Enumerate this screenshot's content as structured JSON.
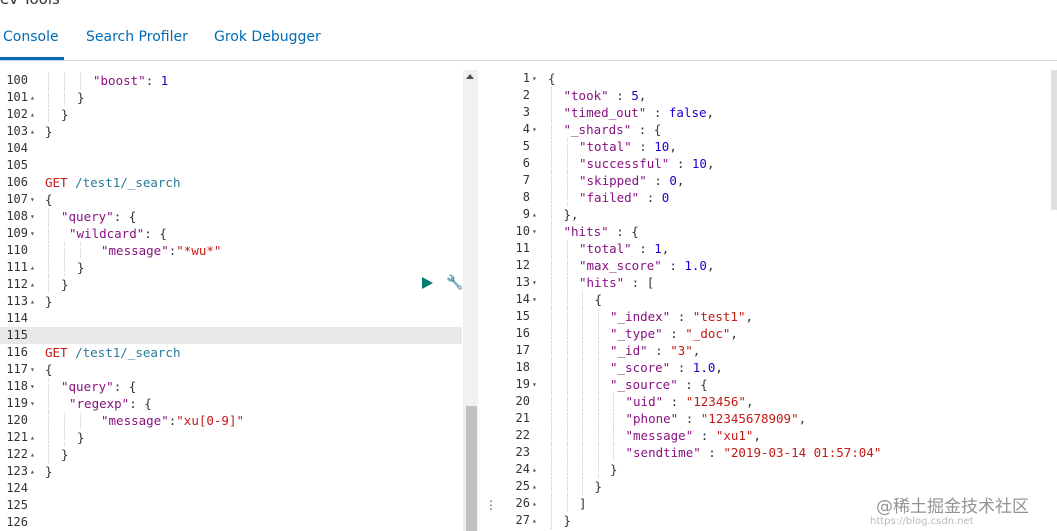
{
  "app": {
    "title": "ev Tools"
  },
  "tabs": [
    {
      "label": "Console"
    },
    {
      "label": "Search Profiler"
    },
    {
      "label": "Grok Debugger"
    }
  ],
  "watermark": "@稀土掘金技术社区",
  "watermark_url": "https://blog.csdn.net",
  "left_lines": [
    {
      "n": "100",
      "fold": "",
      "indent": 3,
      "t": [
        [
          "k",
          "\"boost\""
        ],
        [
          "p",
          ": "
        ],
        [
          "n",
          "1"
        ]
      ]
    },
    {
      "n": "101",
      "fold": "▴",
      "indent": 2,
      "t": [
        [
          "p",
          "}"
        ]
      ]
    },
    {
      "n": "102",
      "fold": "▴",
      "indent": 1,
      "t": [
        [
          "p",
          "}"
        ]
      ]
    },
    {
      "n": "103",
      "fold": "▴",
      "indent": 0,
      "t": [
        [
          "p",
          "}"
        ]
      ]
    },
    {
      "n": "104",
      "fold": "",
      "indent": 0,
      "t": []
    },
    {
      "n": "105",
      "fold": "",
      "indent": 0,
      "t": []
    },
    {
      "n": "106",
      "fold": "",
      "indent": 0,
      "t": [
        [
          "method",
          "GET "
        ],
        [
          "url",
          "/test1/_search"
        ]
      ]
    },
    {
      "n": "107",
      "fold": "▾",
      "indent": 0,
      "t": [
        [
          "p",
          "{"
        ]
      ]
    },
    {
      "n": "108",
      "fold": "▾",
      "indent": 1,
      "t": [
        [
          "k",
          "\"query\""
        ],
        [
          "p",
          ": {"
        ]
      ]
    },
    {
      "n": "109",
      "fold": "▾",
      "indent": 1.5,
      "t": [
        [
          "k",
          "\"wildcard\""
        ],
        [
          "p",
          ": {"
        ]
      ]
    },
    {
      "n": "110",
      "fold": "",
      "indent": 3.5,
      "t": [
        [
          "k",
          "\"message\""
        ],
        [
          "p",
          ":"
        ],
        [
          "str",
          "\"*wu*\""
        ]
      ]
    },
    {
      "n": "111",
      "fold": "▴",
      "indent": 2,
      "t": [
        [
          "p",
          "}"
        ]
      ]
    },
    {
      "n": "112",
      "fold": "▴",
      "indent": 1,
      "t": [
        [
          "p",
          "}"
        ]
      ]
    },
    {
      "n": "113",
      "fold": "▴",
      "indent": 0,
      "t": [
        [
          "p",
          "}"
        ]
      ]
    },
    {
      "n": "114",
      "fold": "",
      "indent": 0,
      "t": []
    },
    {
      "n": "115",
      "fold": "",
      "indent": 0,
      "t": []
    },
    {
      "n": "116",
      "fold": "",
      "indent": 0,
      "t": [
        [
          "method",
          "GET "
        ],
        [
          "url",
          "/test1/_search"
        ]
      ]
    },
    {
      "n": "117",
      "fold": "▾",
      "indent": 0,
      "t": [
        [
          "p",
          "{"
        ]
      ]
    },
    {
      "n": "118",
      "fold": "▾",
      "indent": 1,
      "t": [
        [
          "k",
          "\"query\""
        ],
        [
          "p",
          ": {"
        ]
      ]
    },
    {
      "n": "119",
      "fold": "▾",
      "indent": 1.5,
      "t": [
        [
          "k",
          "\"regexp\""
        ],
        [
          "p",
          ": {"
        ]
      ]
    },
    {
      "n": "120",
      "fold": "",
      "indent": 3.5,
      "t": [
        [
          "k",
          "\"message\""
        ],
        [
          "p",
          ":"
        ],
        [
          "str",
          "\"xu[0-9]\""
        ]
      ]
    },
    {
      "n": "121",
      "fold": "▴",
      "indent": 2,
      "t": [
        [
          "p",
          "}"
        ]
      ]
    },
    {
      "n": "122",
      "fold": "▴",
      "indent": 1,
      "t": [
        [
          "p",
          "}"
        ]
      ]
    },
    {
      "n": "123",
      "fold": "▴",
      "indent": 0,
      "t": [
        [
          "p",
          "}"
        ]
      ]
    },
    {
      "n": "124",
      "fold": "",
      "indent": 0,
      "t": []
    },
    {
      "n": "125",
      "fold": "",
      "indent": 0,
      "t": []
    },
    {
      "n": "126",
      "fold": "",
      "indent": 0,
      "t": []
    }
  ],
  "right_lines": [
    {
      "n": "1",
      "fold": "▾",
      "indent": 0,
      "t": [
        [
          "p",
          "{"
        ]
      ]
    },
    {
      "n": "2",
      "fold": "",
      "indent": 1,
      "t": [
        [
          "k",
          "\"took\""
        ],
        [
          "p",
          " : "
        ],
        [
          "n",
          "5"
        ],
        [
          "p",
          ","
        ]
      ]
    },
    {
      "n": "3",
      "fold": "",
      "indent": 1,
      "t": [
        [
          "k",
          "\"timed_out\""
        ],
        [
          "p",
          " : "
        ],
        [
          "kw",
          "false"
        ],
        [
          "p",
          ","
        ]
      ]
    },
    {
      "n": "4",
      "fold": "▾",
      "indent": 1,
      "t": [
        [
          "k",
          "\"_shards\""
        ],
        [
          "p",
          " : {"
        ]
      ]
    },
    {
      "n": "5",
      "fold": "",
      "indent": 2,
      "t": [
        [
          "k",
          "\"total\""
        ],
        [
          "p",
          " : "
        ],
        [
          "n",
          "10"
        ],
        [
          "p",
          ","
        ]
      ]
    },
    {
      "n": "6",
      "fold": "",
      "indent": 2,
      "t": [
        [
          "k",
          "\"successful\""
        ],
        [
          "p",
          " : "
        ],
        [
          "n",
          "10"
        ],
        [
          "p",
          ","
        ]
      ]
    },
    {
      "n": "7",
      "fold": "",
      "indent": 2,
      "t": [
        [
          "k",
          "\"skipped\""
        ],
        [
          "p",
          " : "
        ],
        [
          "n",
          "0"
        ],
        [
          "p",
          ","
        ]
      ]
    },
    {
      "n": "8",
      "fold": "",
      "indent": 2,
      "t": [
        [
          "k",
          "\"failed\""
        ],
        [
          "p",
          " : "
        ],
        [
          "n",
          "0"
        ]
      ]
    },
    {
      "n": "9",
      "fold": "▴",
      "indent": 1,
      "t": [
        [
          "p",
          "},"
        ]
      ]
    },
    {
      "n": "10",
      "fold": "▾",
      "indent": 1,
      "t": [
        [
          "k",
          "\"hits\""
        ],
        [
          "p",
          " : {"
        ]
      ]
    },
    {
      "n": "11",
      "fold": "",
      "indent": 2,
      "t": [
        [
          "k",
          "\"total\""
        ],
        [
          "p",
          " : "
        ],
        [
          "n",
          "1"
        ],
        [
          "p",
          ","
        ]
      ]
    },
    {
      "n": "12",
      "fold": "",
      "indent": 2,
      "t": [
        [
          "k",
          "\"max_score\""
        ],
        [
          "p",
          " : "
        ],
        [
          "n",
          "1.0"
        ],
        [
          "p",
          ","
        ]
      ]
    },
    {
      "n": "13",
      "fold": "▾",
      "indent": 2,
      "t": [
        [
          "k",
          "\"hits\""
        ],
        [
          "p",
          " : ["
        ]
      ]
    },
    {
      "n": "14",
      "fold": "▾",
      "indent": 3,
      "t": [
        [
          "p",
          "{"
        ]
      ]
    },
    {
      "n": "15",
      "fold": "",
      "indent": 4,
      "t": [
        [
          "k",
          "\"_index\""
        ],
        [
          "p",
          " : "
        ],
        [
          "str",
          "\"test1\""
        ],
        [
          "p",
          ","
        ]
      ]
    },
    {
      "n": "16",
      "fold": "",
      "indent": 4,
      "t": [
        [
          "k",
          "\"_type\""
        ],
        [
          "p",
          " : "
        ],
        [
          "str",
          "\"_doc\""
        ],
        [
          "p",
          ","
        ]
      ]
    },
    {
      "n": "17",
      "fold": "",
      "indent": 4,
      "t": [
        [
          "k",
          "\"_id\""
        ],
        [
          "p",
          " : "
        ],
        [
          "str",
          "\"3\""
        ],
        [
          "p",
          ","
        ]
      ]
    },
    {
      "n": "18",
      "fold": "",
      "indent": 4,
      "t": [
        [
          "k",
          "\"_score\""
        ],
        [
          "p",
          " : "
        ],
        [
          "n",
          "1.0"
        ],
        [
          "p",
          ","
        ]
      ]
    },
    {
      "n": "19",
      "fold": "▾",
      "indent": 4,
      "t": [
        [
          "k",
          "\"_source\""
        ],
        [
          "p",
          " : {"
        ]
      ]
    },
    {
      "n": "20",
      "fold": "",
      "indent": 5,
      "t": [
        [
          "k",
          "\"uid\""
        ],
        [
          "p",
          " : "
        ],
        [
          "str",
          "\"123456\""
        ],
        [
          "p",
          ","
        ]
      ]
    },
    {
      "n": "21",
      "fold": "",
      "indent": 5,
      "t": [
        [
          "k",
          "\"phone\""
        ],
        [
          "p",
          " : "
        ],
        [
          "str",
          "\"12345678909\""
        ],
        [
          "p",
          ","
        ]
      ]
    },
    {
      "n": "22",
      "fold": "",
      "indent": 5,
      "t": [
        [
          "k",
          "\"message\""
        ],
        [
          "p",
          " : "
        ],
        [
          "str",
          "\"xu1\""
        ],
        [
          "p",
          ","
        ]
      ]
    },
    {
      "n": "23",
      "fold": "",
      "indent": 5,
      "t": [
        [
          "k",
          "\"sendtime\""
        ],
        [
          "p",
          " : "
        ],
        [
          "str",
          "\"2019-03-14 01:57:04\""
        ]
      ]
    },
    {
      "n": "24",
      "fold": "▴",
      "indent": 4,
      "t": [
        [
          "p",
          "}"
        ]
      ]
    },
    {
      "n": "25",
      "fold": "▴",
      "indent": 3,
      "t": [
        [
          "p",
          "}"
        ]
      ]
    },
    {
      "n": "26",
      "fold": "▴",
      "indent": 2,
      "t": [
        [
          "p",
          "]"
        ]
      ]
    },
    {
      "n": "27",
      "fold": "▴",
      "indent": 1,
      "t": [
        [
          "p",
          "}"
        ]
      ]
    }
  ]
}
